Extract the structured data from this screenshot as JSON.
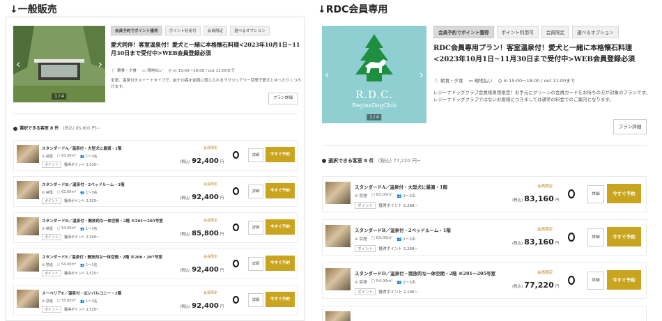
{
  "headings": {
    "left": "↓一般販売",
    "right": "↓RDC会員専用"
  },
  "left": {
    "tags": [
      "会員予約でポイント獲得",
      "ポイント利用可",
      "会員限定",
      "選べるオプション"
    ],
    "slider_counter": "1 / 4",
    "plan_title": "愛犬同伴！客室温泉付！愛犬と一緒に本格懐石料理<2023年10月1日~11月30日まで受付中>WEB会員登録必須",
    "meta": {
      "meals": "朝食・夕食",
      "payment": "現地払い",
      "time": "in 15:00〜18:00 / out 11:00まで"
    },
    "description": "全室、温泉付きスイートタイプで、前士の森を前面に感じられるラグジュアリー空間で愛犬とゆったりくつろげます。",
    "detail_label": "プラン詳細",
    "available_count": "選択できる客室 8 件",
    "available_price": "(税込) 85,800 円~",
    "rooms": [
      {
        "name": "スタンダードA／温泉付・大型犬に最適・1階",
        "meta1": "禁煙",
        "meta2": "63.00m²",
        "meta3": "1〜3名",
        "points": "獲得ポイント 2,520~",
        "member": "会員限定",
        "price_pre": "(税込)",
        "price": "92,400",
        "yen": "円"
      },
      {
        "name": "スタンダードB／温泉付・2ベッドルーム・1階",
        "meta1": "禁煙",
        "meta2": "63.00m²",
        "meta3": "1〜3名",
        "points": "獲得ポイント 2,520~",
        "member": "会員限定",
        "price_pre": "(税込)",
        "price": "92,400",
        "yen": "円"
      },
      {
        "name": "スタンダードD／温泉付・開放的な一体空間・2階 ※201〜205号室",
        "meta1": "禁煙",
        "meta2": "54.00m²",
        "meta3": "1〜3名",
        "points": "獲得ポイント 2,340~",
        "member": "会員限定",
        "price_pre": "(税込)",
        "price": "85,800",
        "yen": "円"
      },
      {
        "name": "スタンダードF／温泉付・開放的な一体空間・2階 ※206・207号室",
        "meta1": "禁煙",
        "meta2": "54.00m²",
        "meta3": "1〜3名",
        "points": "獲得ポイント 2,520~",
        "member": "会員限定",
        "price_pre": "(税込)",
        "price": "92,400",
        "yen": "円"
      },
      {
        "name": "スーペリアE／温泉付・広いバルコニー・2階",
        "meta1": "禁煙",
        "meta2": "55.00m²",
        "meta3": "1〜3名",
        "points": "獲得ポイント 2,520~",
        "member": "会員限定",
        "price_pre": "(税込)",
        "price": "92,400",
        "yen": "円"
      }
    ],
    "detail_btn": "詳細",
    "book_btn": "今すぐ予約",
    "points_badge": "ポイント"
  },
  "right": {
    "tags": [
      "会員予約でポイント獲得",
      "ポイント利用可",
      "会員限定",
      "選べるオプション"
    ],
    "slider_counter": "1 / 4",
    "logo_letters": "R.D.C.",
    "logo_sub": "ReginaDogClub",
    "plan_title": "RDC会員専用プラン！客室温泉付！愛犬と一緒に本格懐石料理<2023年10月1日~11月30日まで受付中>WEB会員登録必須",
    "meta": {
      "meals": "朝食・夕食",
      "payment": "現地払い",
      "time": "in 15:00〜18:00 / out 11:00まで"
    },
    "description": "レジーナドッグクラブ会員様専用限定！お手元にグリーンの会員カードをお持ちの方が対象のプランです。レジーナドッグクラブではないお客様につきましては通常の料金でのご案内となります。",
    "detail_label": "プラン詳細",
    "available_count": "選択できる客室 8 件",
    "available_price": "(税込) 77,220 円~",
    "rooms": [
      {
        "name": "スタンダードA／温泉付・大型犬に最適・1階",
        "meta1": "禁煙",
        "meta2": "63.00m²",
        "meta3": "1〜3名",
        "points": "獲得ポイント 2,268~",
        "member": "会員限定",
        "price_pre": "(税込)",
        "price": "83,160",
        "yen": "円"
      },
      {
        "name": "スタンダードB／温泉付・2ベッドルーム・1階",
        "meta1": "禁煙",
        "meta2": "63.00m²",
        "meta3": "1〜3名",
        "points": "獲得ポイント 2,268~",
        "member": "会員限定",
        "price_pre": "(税込)",
        "price": "83,160",
        "yen": "円"
      },
      {
        "name": "スタンダードD／温泉付・開放的な一体空間・2階 ※201〜205号室",
        "meta1": "禁煙",
        "meta2": "54.00m²",
        "meta3": "1〜3名",
        "points": "獲得ポイント 2,106~",
        "member": "会員限定",
        "price_pre": "(税込)",
        "price": "77,220",
        "yen": "円"
      }
    ],
    "detail_btn": "詳細",
    "book_btn": "今すぐ予約",
    "points_badge": "ポイント"
  },
  "colors": {
    "accent_gold": "#c8a41f",
    "rdc_teal": "#8fcfd1",
    "rdc_green": "#1e8f3e"
  }
}
